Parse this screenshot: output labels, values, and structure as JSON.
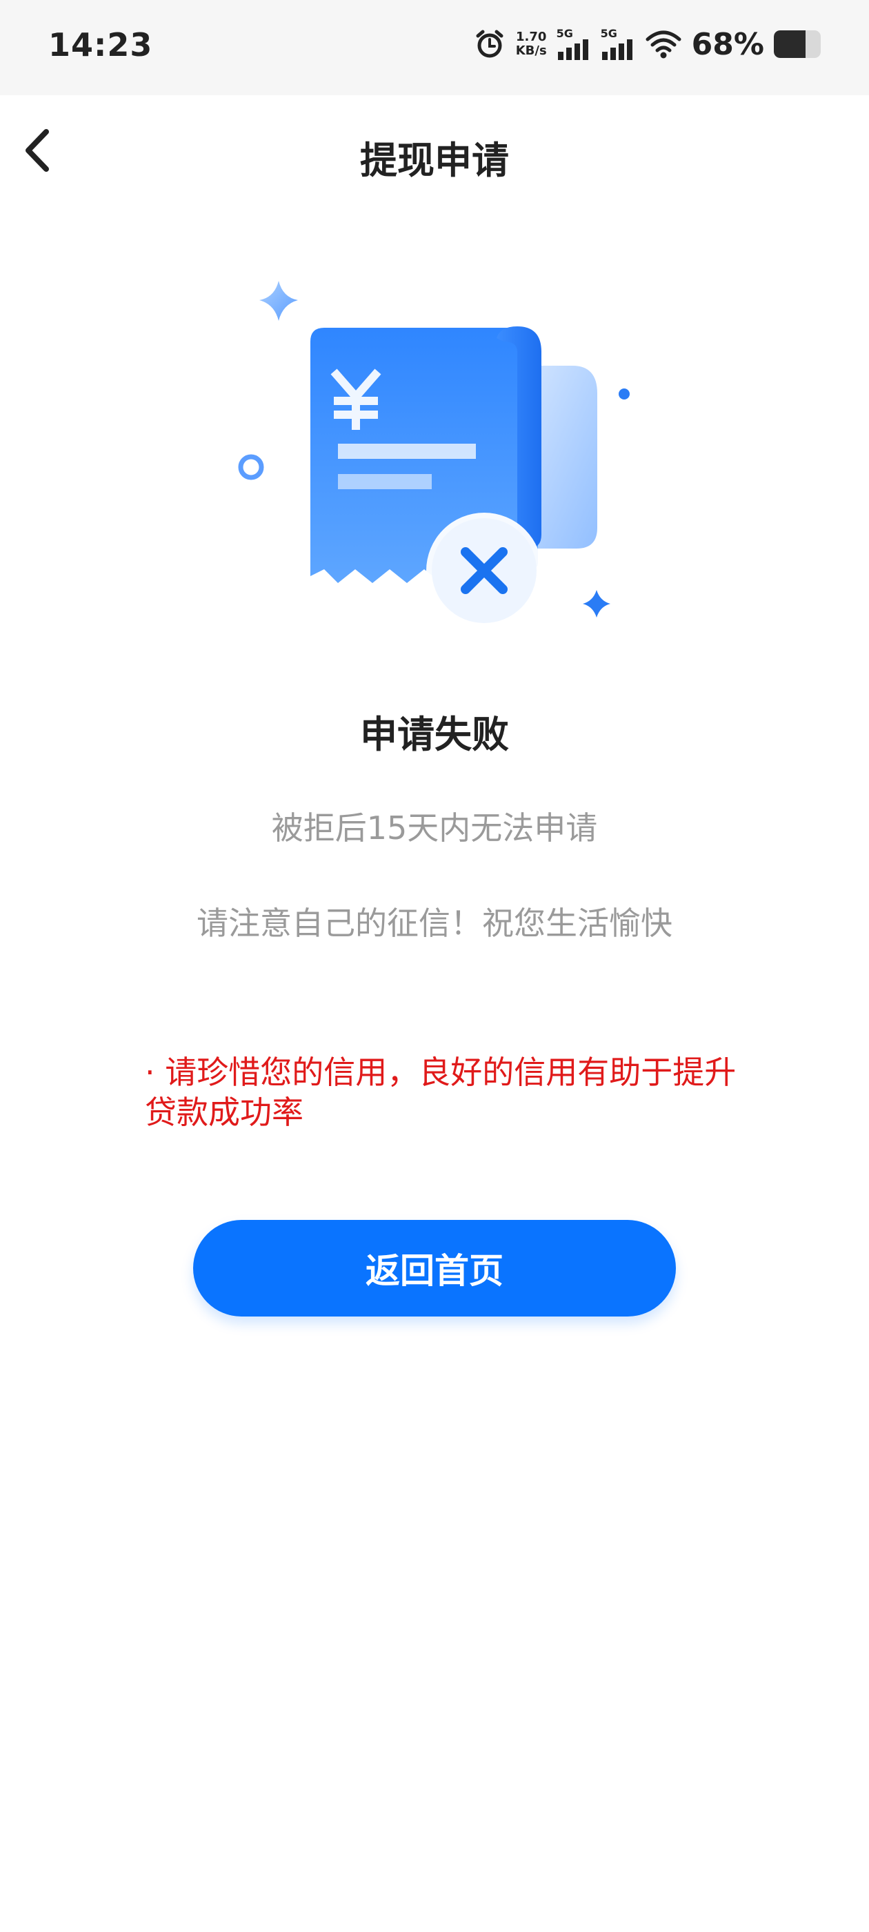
{
  "status_bar": {
    "time": "14:23",
    "net_speed_value": "1.70",
    "net_speed_unit": "KB/s",
    "sim1_label": "5G",
    "sim2_label": "5G",
    "battery_percent_text": "68%",
    "battery_level": 0.68,
    "icons": [
      "alarm-icon",
      "signal-icon",
      "wifi-icon",
      "battery-icon"
    ]
  },
  "nav": {
    "title": "提现申请",
    "back_icon": "chevron-left-icon"
  },
  "result": {
    "illustration_icon": "receipt-failed-icon",
    "title": "申请失败",
    "message_1": "被拒后15天内无法申请",
    "message_2": "请注意自己的征信！祝您生活愉快",
    "notice": "· 请珍惜您的信用，良好的信用有助于提升贷款成功率",
    "button_label": "返回首页"
  },
  "colors": {
    "accent": "#0a74ff",
    "notice_red": "#e01a1a",
    "muted_text": "#9a9a9a",
    "title_text": "#222222"
  }
}
